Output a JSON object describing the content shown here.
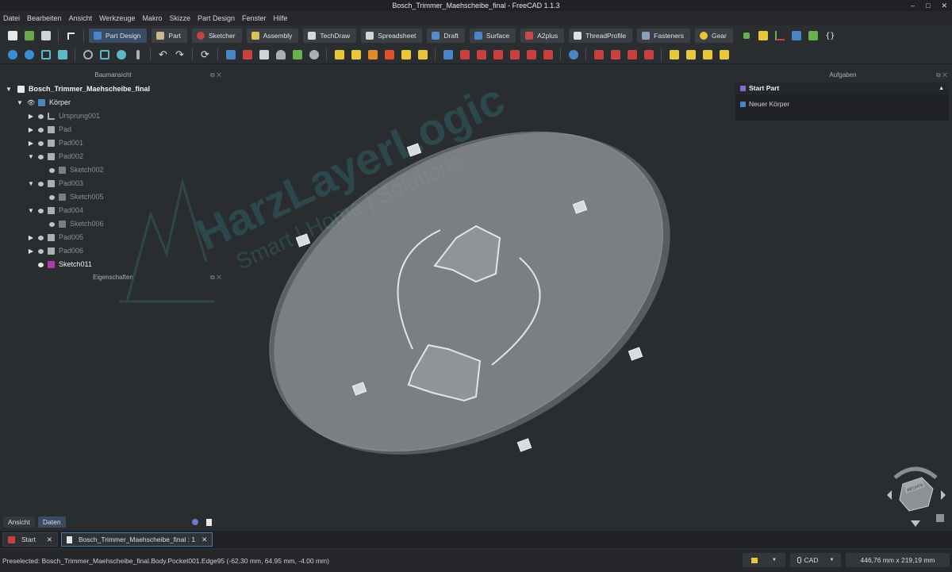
{
  "window": {
    "title": "Bosch_Trimmer_Maehscheibe_final - FreeCAD 1.1.3",
    "controls": [
      "–",
      "□",
      "✕"
    ]
  },
  "menu": [
    "Datei",
    "Bearbeiten",
    "Ansicht",
    "Werkzeuge",
    "Makro",
    "Skizze",
    "Part Design",
    "Fenster",
    "Hilfe"
  ],
  "workbenches": [
    {
      "label": "Part Design",
      "color": "#4a86c7",
      "active": true
    },
    {
      "label": "Part",
      "color": "#c9b98a"
    },
    {
      "label": "Sketcher",
      "color": "#c94040"
    },
    {
      "label": "Assembly",
      "color": "#d6c455"
    },
    {
      "label": "TechDraw",
      "color": "#d9d9d9"
    },
    {
      "label": "Spreadsheet",
      "color": "#cfd8cf"
    },
    {
      "label": "Draft",
      "color": "#5a8ac9"
    },
    {
      "label": "Surface",
      "color": "#4a86c7"
    },
    {
      "label": "A2plus",
      "color": "#c94a4a"
    },
    {
      "label": "ThreadProfile",
      "color": "#e0e0e0"
    },
    {
      "label": "Fasteners",
      "color": "#8aa0b8"
    },
    {
      "label": "Gear",
      "color": "#e8c83a"
    }
  ],
  "tree": {
    "header": "Baumansicht",
    "root": "Bosch_Trimmer_Maehscheibe_final",
    "body": "Körper",
    "items": [
      {
        "label": "Ursprung001",
        "indent": 1,
        "arrow": "▶",
        "dim": true
      },
      {
        "label": "Pad",
        "indent": 1,
        "arrow": "▶",
        "dim": true
      },
      {
        "label": "Pad001",
        "indent": 1,
        "arrow": "▶",
        "dim": true
      },
      {
        "label": "Pad002",
        "indent": 1,
        "arrow": "▼",
        "dim": true
      },
      {
        "label": "Sketch002",
        "indent": 2,
        "arrow": "",
        "dim": true
      },
      {
        "label": "Pad003",
        "indent": 1,
        "arrow": "▼",
        "dim": true
      },
      {
        "label": "Sketch005",
        "indent": 2,
        "arrow": "",
        "dim": true
      },
      {
        "label": "Pad004",
        "indent": 1,
        "arrow": "▼",
        "dim": true
      },
      {
        "label": "Sketch006",
        "indent": 2,
        "arrow": "",
        "dim": true
      },
      {
        "label": "Pad005",
        "indent": 1,
        "arrow": "▶",
        "dim": true
      },
      {
        "label": "Pad006",
        "indent": 1,
        "arrow": "▶",
        "dim": true
      },
      {
        "label": "Sketch011",
        "indent": 1,
        "arrow": "",
        "dim": false
      }
    ]
  },
  "properties_header": "Eigenschaften",
  "watermark": {
    "line1": "HarzLayerLogic",
    "line2": "Smart | Home | Solutions"
  },
  "tasks": {
    "header": "Aufgaben",
    "title": "Start Part",
    "item": "Neuer Körper"
  },
  "bottom_tabs": [
    "Ansicht",
    "Daten"
  ],
  "doc_tabs": [
    {
      "label": "Start",
      "close": "✕"
    },
    {
      "label": "Bosch_Trimmer_Maehscheibe_final : 1",
      "close": "✕"
    }
  ],
  "status": {
    "message": "Preselected: Bosch_Trimmer_Maehscheibe_final.Body.Pocket001.Edge95 (-62.30 mm, 64.95 mm, -4.00 mm)",
    "nav_style": "CAD",
    "dimensions": "446,76 mm x 219,19 mm"
  },
  "navcube_label": "RECHTS"
}
